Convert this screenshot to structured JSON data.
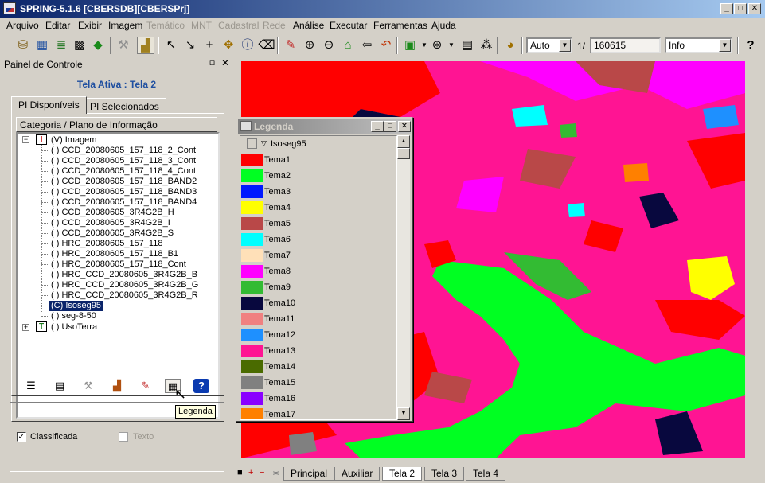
{
  "window": {
    "title": "SPRING-5.1.6 [CBERSDB][CBERSPrj]"
  },
  "menu": [
    "Arquivo",
    "Editar",
    "Exibir",
    "Imagem",
    "Temático",
    "MNT",
    "Cadastral",
    "Rede",
    "Análise",
    "Executar",
    "Ferramentas",
    "Ajuda"
  ],
  "menu_disabled": [
    "Temático",
    "MNT",
    "Cadastral",
    "Rede"
  ],
  "toolbar": {
    "scale_mode": "Auto",
    "scale_prefix": "1/",
    "scale_value": "160615",
    "info_mode": "Info"
  },
  "panel": {
    "title": "Painel de Controle",
    "active_screen": "Tela Ativa : Tela 2",
    "tabs": [
      "PI Disponíveis",
      "PI Selecionados"
    ],
    "tree_header": "Categoria / Plano de Informação",
    "category_image": "(V) Imagem",
    "image_layers": [
      "( ) CCD_20080605_157_118_2_Cont",
      "( ) CCD_20080605_157_118_3_Cont",
      "( ) CCD_20080605_157_118_4_Cont",
      "( ) CCD_20080605_157_118_BAND2",
      "( ) CCD_20080605_157_118_BAND3",
      "( ) CCD_20080605_157_118_BAND4",
      "( ) CCD_20080605_3R4G2B_H",
      "( ) CCD_20080605_3R4G2B_I",
      "( ) CCD_20080605_3R4G2B_S",
      "( ) HRC_20080605_157_118",
      "( ) HRC_20080605_157_118_B1",
      "( ) HRC_20080605_157_118_Cont",
      "( ) HRC_CCD_20080605_3R4G2B_B",
      "( ) HRC_CCD_20080605_3R4G2B_G",
      "( ) HRC_CCD_20080605_3R4G2B_R",
      "(C) Isoseg95",
      "( ) seg-8-50"
    ],
    "selected_layer": "(C) Isoseg95",
    "category_theme": "( ) UsoTerra",
    "check_classified": "Classificada",
    "check_text": "Texto",
    "tooltip": "Legenda"
  },
  "legend": {
    "title": "Legenda",
    "layer": "Isoseg95",
    "items": [
      {
        "label": "Tema1",
        "color": "#ff0000"
      },
      {
        "label": "Tema2",
        "color": "#00ff22"
      },
      {
        "label": "Tema3",
        "color": "#0018ff"
      },
      {
        "label": "Tema4",
        "color": "#ffff00"
      },
      {
        "label": "Tema5",
        "color": "#b94848"
      },
      {
        "label": "Tema6",
        "color": "#00ffff"
      },
      {
        "label": "Tema7",
        "color": "#ffe0b8"
      },
      {
        "label": "Tema8",
        "color": "#ff00ff"
      },
      {
        "label": "Tema9",
        "color": "#33bb33"
      },
      {
        "label": "Tema10",
        "color": "#08083e"
      },
      {
        "label": "Tema11",
        "color": "#f08080"
      },
      {
        "label": "Tema12",
        "color": "#1e90ff"
      },
      {
        "label": "Tema13",
        "color": "#ff1493"
      },
      {
        "label": "Tema14",
        "color": "#4a6b00"
      },
      {
        "label": "Tema15",
        "color": "#808080"
      },
      {
        "label": "Tema16",
        "color": "#8a00ff"
      },
      {
        "label": "Tema17",
        "color": "#ff8000"
      }
    ]
  },
  "view_tabs": [
    "Principal",
    "Auxiliar",
    "Tela 2",
    "Tela 3",
    "Tela 4"
  ],
  "active_view_tab": "Tela 2"
}
